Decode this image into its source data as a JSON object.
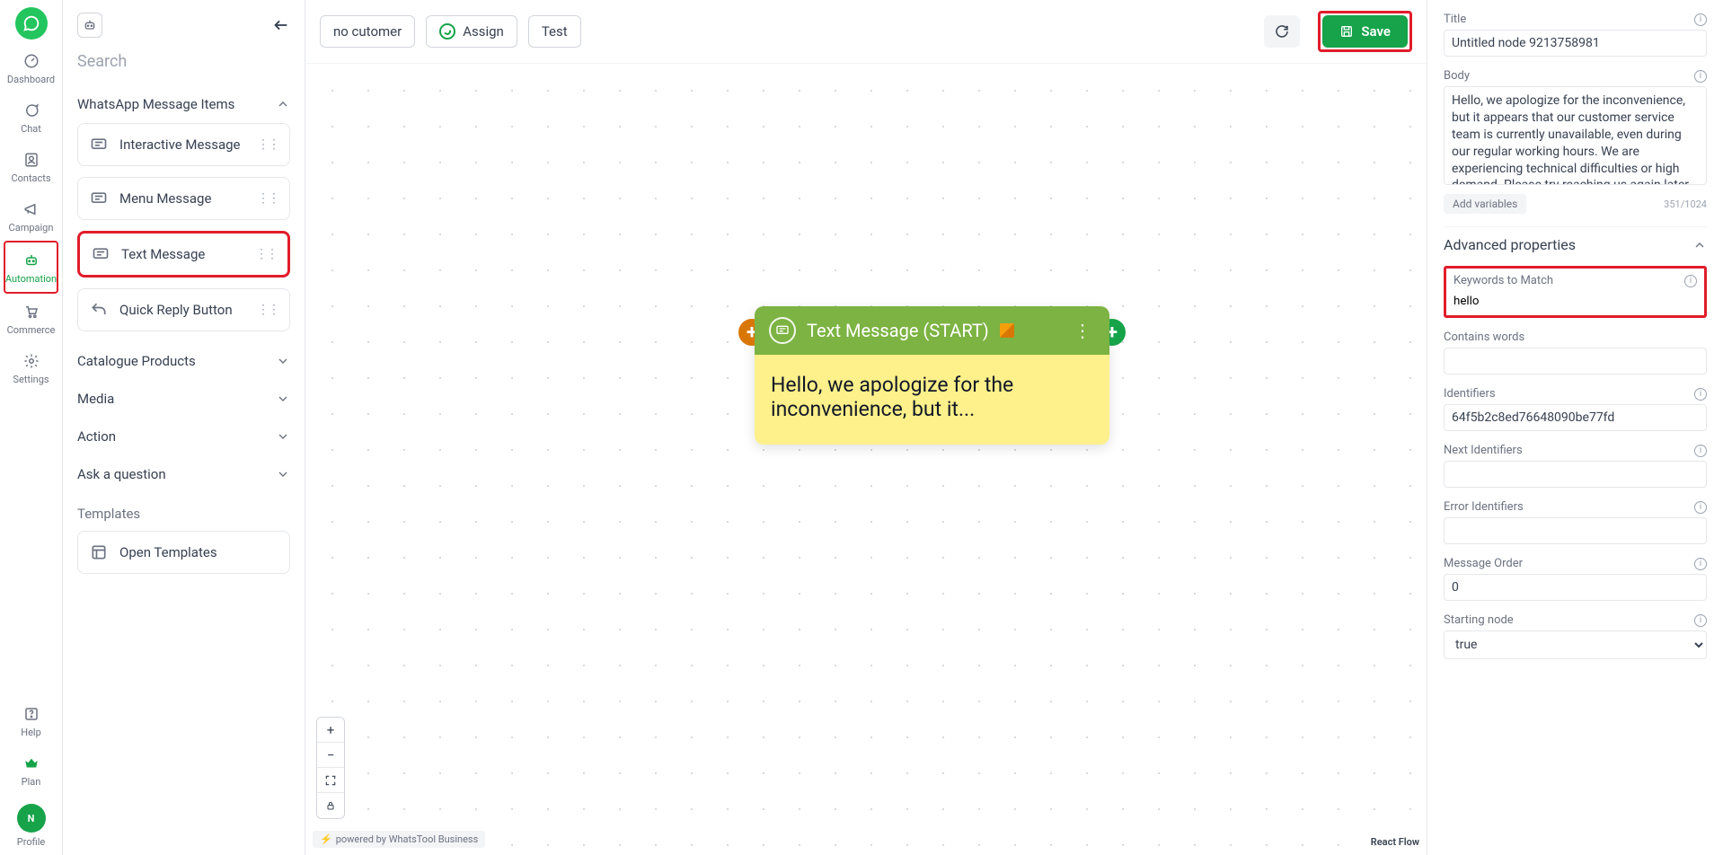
{
  "nav": {
    "items": [
      {
        "label": "Dashboard"
      },
      {
        "label": "Chat"
      },
      {
        "label": "Contacts"
      },
      {
        "label": "Campaign"
      },
      {
        "label": "Automation"
      },
      {
        "label": "Commerce"
      },
      {
        "label": "Settings"
      }
    ],
    "bottom": [
      {
        "label": "Help"
      },
      {
        "label": "Plan"
      },
      {
        "label": "Profile"
      }
    ],
    "avatar_initial": "N"
  },
  "sidebar": {
    "search_placeholder": "Search",
    "groups": {
      "whatsapp": {
        "title": "WhatsApp Message Items",
        "items": [
          {
            "label": "Interactive Message"
          },
          {
            "label": "Menu Message"
          },
          {
            "label": "Text Message"
          },
          {
            "label": "Quick Reply Button"
          }
        ]
      },
      "catalogue": {
        "title": "Catalogue Products"
      },
      "media": {
        "title": "Media"
      },
      "action": {
        "title": "Action"
      },
      "ask": {
        "title": "Ask a question"
      }
    },
    "templates_label": "Templates",
    "open_templates": "Open Templates"
  },
  "toolbar": {
    "no_customer": "no cutomer",
    "assign": "Assign",
    "test": "Test",
    "save": "Save"
  },
  "canvas": {
    "node_title": "Text Message (START)",
    "node_preview": "Hello, we apologize for the inconvenience, but it...",
    "powered": "powered by WhatsTool Business",
    "reactflow": "React Flow"
  },
  "props": {
    "title_label": "Title",
    "title_value": "Untitled node 9213758981",
    "body_label": "Body",
    "body_value": "Hello, we apologize for the inconvenience, but it appears that our customer service team is currently unavailable, even during our regular working hours. We are experiencing technical difficulties or high demand. Please try reaching us again later, or you can leave a",
    "add_variables": "Add variables",
    "char_count": "351/1024",
    "advanced_label": "Advanced properties",
    "keywords_label": "Keywords to Match",
    "keywords_value": "hello",
    "contains_label": "Contains words",
    "contains_value": "",
    "identifiers_label": "Identifiers",
    "identifiers_value": "64f5b2c8ed76648090be77fd",
    "next_label": "Next Identifiers",
    "next_value": "",
    "error_label": "Error Identifiers",
    "error_value": "",
    "order_label": "Message Order",
    "order_value": "0",
    "starting_label": "Starting node",
    "starting_value": "true"
  }
}
